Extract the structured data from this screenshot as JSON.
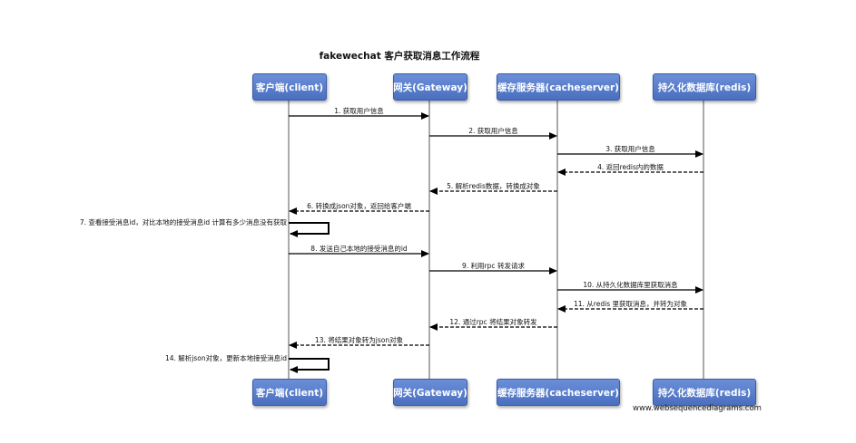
{
  "title": "fakewechat 客户获取消息工作流程",
  "actors": [
    {
      "label": "客户端(client)"
    },
    {
      "label": "网关(Gateway)"
    },
    {
      "label": "缓存服务器(cacheserver)"
    },
    {
      "label": "持久化数据库(redis)"
    }
  ],
  "messages": [
    {
      "label": "1. 获取用户信息",
      "from": 0,
      "to": 1,
      "dashed": false
    },
    {
      "label": "2. 获取用户信息",
      "from": 1,
      "to": 2,
      "dashed": false
    },
    {
      "label": "3. 获取用户信息",
      "from": 2,
      "to": 3,
      "dashed": false
    },
    {
      "label": "4. 返回redis内的数据",
      "from": 3,
      "to": 2,
      "dashed": true
    },
    {
      "label": "5. 解析redis数据，转换成对象",
      "from": 2,
      "to": 1,
      "dashed": true
    },
    {
      "label": "6. 转换成json对象，返回给客户端",
      "from": 1,
      "to": 0,
      "dashed": true
    },
    {
      "label": "7. 查看接受消息id，对比本地的接受消息id 计算有多少消息没有获取",
      "from": 0,
      "to": 0,
      "dashed": false,
      "self": true
    },
    {
      "label": "8. 发送自己本地的接受消息的id",
      "from": 0,
      "to": 1,
      "dashed": false
    },
    {
      "label": "9. 利用rpc 转发请求",
      "from": 1,
      "to": 2,
      "dashed": false
    },
    {
      "label": "10. 从持久化数据库里获取消息",
      "from": 2,
      "to": 3,
      "dashed": false
    },
    {
      "label": "11. 从redis 里获取消息，并转为对象",
      "from": 3,
      "to": 2,
      "dashed": true
    },
    {
      "label": "12. 通过rpc 将结果对象转发",
      "from": 2,
      "to": 1,
      "dashed": true
    },
    {
      "label": "13. 将结果对象转为json对象",
      "from": 1,
      "to": 0,
      "dashed": true
    },
    {
      "label": "14. 解析json对象，更新本地接受消息id",
      "from": 0,
      "to": 0,
      "dashed": false,
      "self": true
    }
  ],
  "footer": "www.websequencediagrams.com"
}
